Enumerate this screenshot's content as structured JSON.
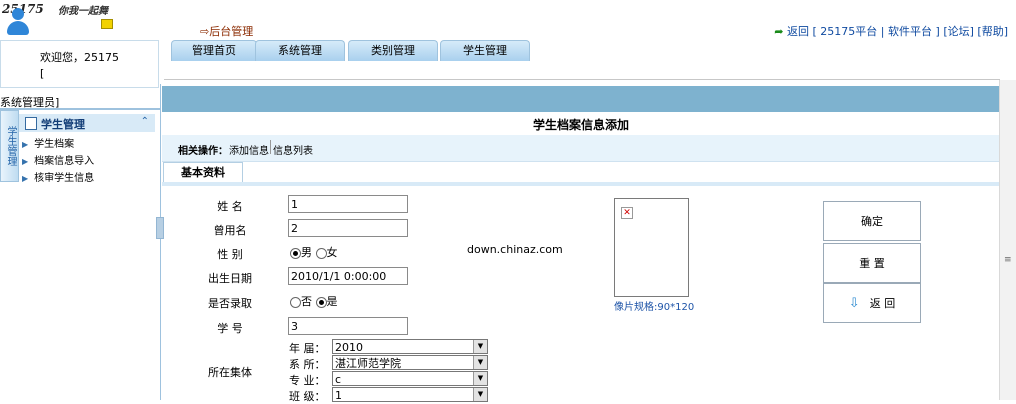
{
  "logo": {
    "site": "25175",
    "slogan": "你我一起舞"
  },
  "header": {
    "backstage": "后台管理",
    "links": [
      "返回",
      "[ 25175平台",
      "|",
      "软件平台 ]",
      "[论坛]",
      "[帮助]"
    ]
  },
  "tabs": [
    "管理首页",
    "系统管理",
    "类别管理",
    "学生管理"
  ],
  "user": {
    "welcome": "欢迎您，25175",
    "line2": "["
  },
  "sidebar": {
    "role": "系统管理员]",
    "vertical_tab": "学生管理",
    "group": "学生管理",
    "items": [
      "学生档案",
      "档案信息导入",
      "核审学生信息"
    ]
  },
  "page": {
    "title": "学生档案信息添加",
    "op_label": "相关操作：",
    "op_links": [
      "添加信息",
      "信息列表"
    ],
    "basic_tab": "基本资料"
  },
  "form": {
    "name_label": "姓 名",
    "name_value": "1",
    "alias_label": "曾用名",
    "alias_value": "2",
    "gender_label": "性 别",
    "gender_options": [
      "男",
      "女"
    ],
    "birth_label": "出生日期",
    "birth_value": "2010/1/1 0:00:00",
    "enrolled_label": "是否录取",
    "enrolled_options": [
      "否",
      "是"
    ],
    "id_label": "学 号",
    "id_value": "3",
    "group_label": "所在集体",
    "year_label": "年 届：",
    "year_value": "2010",
    "dept_label": "系 所：",
    "dept_value": "湛江师范学院",
    "major_label": "专 业：",
    "major_value": "c",
    "class_label": "班 级：",
    "class_value": "1"
  },
  "watermark": "down.chinaz.com",
  "photo_spec": "像片规格:90*120",
  "buttons": {
    "confirm": "确定",
    "reset": "重 置",
    "back": "返 回"
  },
  "scroll_glyph": "≡"
}
